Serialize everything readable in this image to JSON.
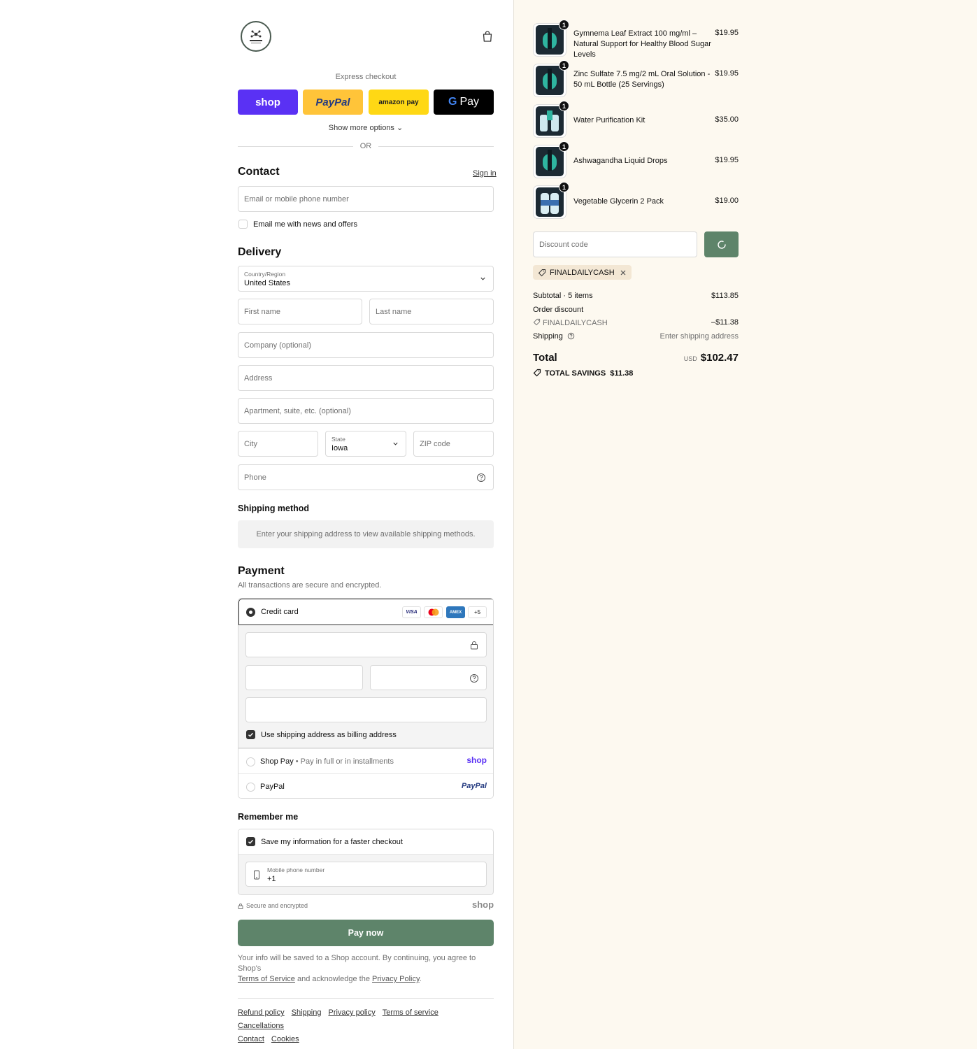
{
  "express": {
    "title": "Express checkout",
    "buttons": {
      "shop": "shop",
      "paypal": "PayPal",
      "amazon": "amazon pay",
      "gpay": "Pay"
    },
    "show_more": "Show more options",
    "or": "OR"
  },
  "contact": {
    "heading": "Contact",
    "sign_in": "Sign in",
    "email_placeholder": "Email or mobile phone number",
    "newsletter": "Email me with news and offers"
  },
  "delivery": {
    "heading": "Delivery",
    "country_label": "Country/Region",
    "country_value": "United States",
    "first_name": "First name",
    "last_name": "Last name",
    "company": "Company (optional)",
    "address": "Address",
    "apartment": "Apartment, suite, etc. (optional)",
    "city": "City",
    "state_label": "State",
    "state_value": "Iowa",
    "zip": "ZIP code",
    "phone": "Phone"
  },
  "shipping_method": {
    "heading": "Shipping method",
    "info": "Enter your shipping address to view available shipping methods."
  },
  "payment": {
    "heading": "Payment",
    "subtitle": "All transactions are secure and encrypted.",
    "credit_card": "Credit card",
    "card_logos": [
      "VISA",
      "MC",
      "AMEX",
      "+5"
    ],
    "billing_same": "Use shipping address as billing address",
    "shop_pay": "Shop Pay",
    "shop_pay_sub": "Pay in full or in installments",
    "shop_pay_logo": "shop",
    "paypal": "PayPal",
    "paypal_logo": "PayPal"
  },
  "remember": {
    "heading": "Remember me",
    "save_info": "Save my information for a faster checkout",
    "mobile_label": "Mobile phone number",
    "mobile_value": "+1"
  },
  "secure": {
    "text": "Secure and encrypted",
    "logo": "shop"
  },
  "pay_now": "Pay now",
  "legal": {
    "part1": "Your info will be saved to a Shop account. By continuing, you agree to Shop's",
    "tos": "Terms of Service",
    "part2": "and acknowledge the",
    "privacy": "Privacy Policy",
    "end": "."
  },
  "footer": [
    "Refund policy",
    "Shipping",
    "Privacy policy",
    "Terms of service",
    "Cancellations",
    "Contact",
    "Cookies"
  ],
  "cart": {
    "items": [
      {
        "name": "Gymnema Leaf Extract 100 mg/ml – Natural Support for Healthy Blood Sugar Levels",
        "price": "$19.95",
        "qty": "1"
      },
      {
        "name": "Zinc Sulfate 7.5 mg/2 mL Oral Solution - 50 mL Bottle (25 Servings)",
        "price": "$19.95",
        "qty": "1"
      },
      {
        "name": "Water Purification Kit",
        "price": "$35.00",
        "qty": "1"
      },
      {
        "name": "Ashwagandha Liquid Drops",
        "price": "$19.95",
        "qty": "1"
      },
      {
        "name": "Vegetable Glycerin 2 Pack",
        "price": "$19.00",
        "qty": "1"
      }
    ],
    "discount_placeholder": "Discount code",
    "applied_code": "FINALDAILYCASH",
    "subtotal_label": "Subtotal · 5 items",
    "subtotal_value": "$113.85",
    "order_discount_label": "Order discount",
    "discount_code": "FINALDAILYCASH",
    "discount_value": "–$11.38",
    "shipping_label": "Shipping",
    "shipping_value": "Enter shipping address",
    "total_label": "Total",
    "currency": "USD",
    "total_value": "$102.47",
    "savings_label": "TOTAL SAVINGS",
    "savings_value": "$11.38"
  },
  "colors": {
    "accent": "#5e846a",
    "shop_purple": "#5a31f4",
    "paypal_yellow": "#ffc439",
    "amazon_yellow": "#ffd814",
    "sidebar_bg": "#fdf9f0"
  }
}
